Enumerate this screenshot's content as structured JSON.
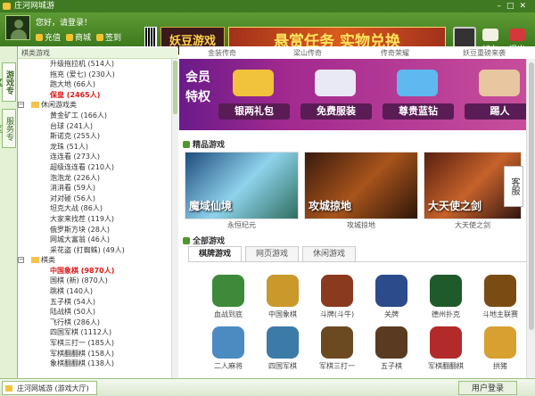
{
  "window": {
    "title": "庄河网城游"
  },
  "header": {
    "greeting": "您好，请登录！",
    "buttons": [
      {
        "label": "充值"
      },
      {
        "label": "商城"
      },
      {
        "label": "签到"
      }
    ],
    "banner1": "妖豆游戏",
    "banner2": "悬赏任务 实物兑换",
    "friends_label": "好友",
    "exit_label": "退出"
  },
  "left": {
    "tab_games": "游戏专区",
    "tab_service": "服务专区",
    "tree_top": "棋类游戏",
    "tree": [
      {
        "type": "leaf",
        "label": "升级拖拉机 (514人)"
      },
      {
        "type": "leaf",
        "label": "拖充 (爱七) (230人)"
      },
      {
        "type": "leaf",
        "label": "跑大地 (66人)"
      },
      {
        "type": "leaf",
        "label": "保皇 (2465人)",
        "red": true
      },
      {
        "type": "cat",
        "label": "休闲游戏类",
        "sign": "−"
      },
      {
        "type": "leaf",
        "label": "黄金矿工 (166人)"
      },
      {
        "type": "leaf",
        "label": "台球 (241人)"
      },
      {
        "type": "leaf",
        "label": "斯诺克 (255人)"
      },
      {
        "type": "leaf",
        "label": "龙珠 (51人)"
      },
      {
        "type": "leaf",
        "label": "连连看 (273人)"
      },
      {
        "type": "leaf",
        "label": "超级连连看 (210人)"
      },
      {
        "type": "leaf",
        "label": "泡泡龙 (226人)"
      },
      {
        "type": "leaf",
        "label": "消消看 (59人)"
      },
      {
        "type": "leaf",
        "label": "对对碰 (56人)"
      },
      {
        "type": "leaf",
        "label": "坦克大战 (86人)"
      },
      {
        "type": "leaf",
        "label": "大家来找茬 (119人)"
      },
      {
        "type": "leaf",
        "label": "俄罗斯方块 (28人)"
      },
      {
        "type": "leaf",
        "label": "网城大富翁 (46人)"
      },
      {
        "type": "leaf",
        "label": "采花盗 (打蜘蛛) (49人)"
      },
      {
        "type": "cat",
        "label": "棋类",
        "sign": "−"
      },
      {
        "type": "leaf",
        "label": "中国象棋 (9870人)",
        "red": true
      },
      {
        "type": "leaf",
        "label": "国棋 (新) (870人)"
      },
      {
        "type": "leaf",
        "label": "跳棋 (140人)"
      },
      {
        "type": "leaf",
        "label": "五子棋 (54人)"
      },
      {
        "type": "leaf",
        "label": "陆战棋 (50人)"
      },
      {
        "type": "leaf",
        "label": "飞行棋 (286人)"
      },
      {
        "type": "leaf",
        "label": "四国军棋 (1112人)"
      },
      {
        "type": "leaf",
        "label": "军棋三打一 (185人)"
      },
      {
        "type": "leaf",
        "label": "军棋翻翻棋 (158人)"
      },
      {
        "type": "leaf",
        "label": "象棋翻翻棋 (138人)"
      }
    ]
  },
  "main": {
    "top_games": [
      "金装传奇",
      "梁山传奇",
      "传奇荣耀",
      "妖豆重磅来袭"
    ],
    "member_label": "会员特权",
    "member_items": [
      {
        "label": "银两礼包"
      },
      {
        "label": "免费服装"
      },
      {
        "label": "尊贵蓝钻"
      },
      {
        "label": "踢人"
      }
    ],
    "featured_section": "精品游戏",
    "featured": [
      {
        "title": "魔域仙境",
        "name": "永恒纪元"
      },
      {
        "title": "攻城掠地",
        "name": "攻城掠地"
      },
      {
        "title": "大天使之剑",
        "name": "大天使之剑"
      }
    ],
    "all_section": "全部游戏",
    "tabs": [
      {
        "label": "棋牌游戏"
      },
      {
        "label": "网页游戏"
      },
      {
        "label": "休闲游戏"
      }
    ],
    "games": [
      {
        "label": "血战到底",
        "color": "#3e8a3a"
      },
      {
        "label": "中国象棋",
        "color": "#c9992c"
      },
      {
        "label": "斗牌(斗牛)",
        "color": "#8a3a1f"
      },
      {
        "label": "关牌",
        "color": "#2b4b8a"
      },
      {
        "label": "德州扑克",
        "color": "#1f5a2b"
      },
      {
        "label": "斗地主联赛",
        "color": "#7a4c14"
      },
      {
        "label": "二人麻将",
        "color": "#4c8ac2"
      },
      {
        "label": "四国军棋",
        "color": "#3c7aa8"
      },
      {
        "label": "军棋三打一",
        "color": "#6b4a22"
      },
      {
        "label": "五子棋",
        "color": "#5a3a20"
      },
      {
        "label": "军棋翻翻棋",
        "color": "#b22a2a"
      },
      {
        "label": "拱猪",
        "color": "#d8a030"
      }
    ],
    "service_side": "客服"
  },
  "status": {
    "tab_label": "庄河网城游 (游戏大厅)",
    "login_label": "用户登录"
  }
}
